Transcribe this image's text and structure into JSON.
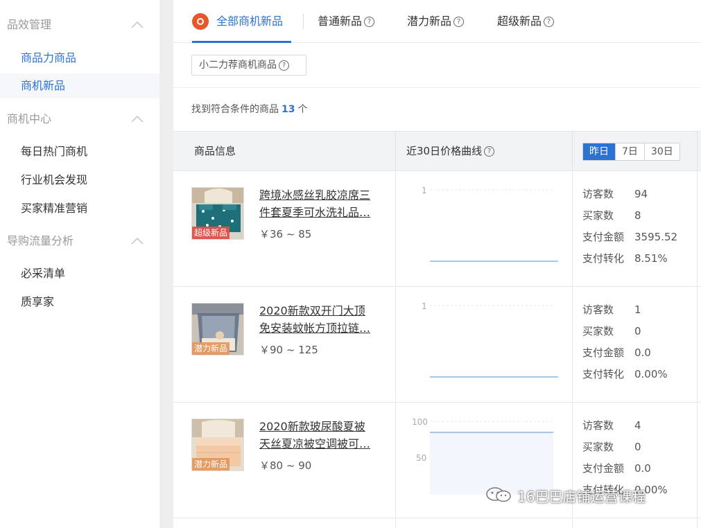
{
  "sidebar": {
    "groups": [
      {
        "title": "品效管理",
        "items": [
          "商品力商品",
          "商机新品"
        ]
      },
      {
        "title": "商机中心",
        "items": [
          "每日热门商机",
          "行业机会发现",
          "买家精准营销"
        ]
      },
      {
        "title": "导购流量分析",
        "items": [
          "必采清单",
          "质享家"
        ]
      }
    ]
  },
  "tabs": [
    {
      "label": "全部商机新品",
      "active": true
    },
    {
      "label": "普通新品",
      "help": "?"
    },
    {
      "label": "潜力新品",
      "help": "?"
    },
    {
      "label": "超级新品",
      "help": "?"
    }
  ],
  "filter": {
    "label": "小二力荐商机商品",
    "help": "?"
  },
  "results": {
    "prefix": "找到符合条件的商品",
    "count": "13",
    "suffix": "个"
  },
  "table": {
    "headers": {
      "info": "商品信息",
      "price_curve": "近30日价格曲线",
      "help": "?"
    },
    "range": [
      "昨日",
      "7日",
      "30日"
    ],
    "rows": [
      {
        "title_line1": "跨境冰感丝乳胶凉席三",
        "title_line2": "件套夏季可水洗礼品…",
        "price": "￥36 ~ 85",
        "tag": "超级新品",
        "axis_top": "1",
        "metrics": [
          {
            "k": "访客数",
            "v": "94"
          },
          {
            "k": "买家数",
            "v": "8"
          },
          {
            "k": "支付金额",
            "v": "3595.52"
          },
          {
            "k": "支付转化",
            "v": "8.51%"
          }
        ]
      },
      {
        "title_line1": "2020新款双开门大顶",
        "title_line2": "免安装蚊帐方顶拉链…",
        "price": "￥90 ~ 125",
        "tag": "潜力新品",
        "axis_top": "1",
        "metrics": [
          {
            "k": "访客数",
            "v": "1"
          },
          {
            "k": "买家数",
            "v": "0"
          },
          {
            "k": "支付金额",
            "v": "0.0"
          },
          {
            "k": "支付转化",
            "v": "0.00%"
          }
        ]
      },
      {
        "title_line1": "2020新款玻尿酸夏被",
        "title_line2": "天丝夏凉被空调被可…",
        "price": "￥80 ~ 90",
        "tag": "潜力新品",
        "axis_top": "100",
        "axis_mid": "50",
        "metrics": [
          {
            "k": "访客数",
            "v": "4"
          },
          {
            "k": "买家数",
            "v": "0"
          },
          {
            "k": "支付金额",
            "v": "0.0"
          },
          {
            "k": "支付转化",
            "v": "0.00%"
          }
        ]
      }
    ]
  },
  "watermark": {
    "text": "16巴巴店铺运营课程"
  },
  "colors": {
    "accent": "#2b73d2",
    "tag_red": "#e15046",
    "tag_orange": "#e6965a",
    "chart_line": "#a8c6ec"
  }
}
